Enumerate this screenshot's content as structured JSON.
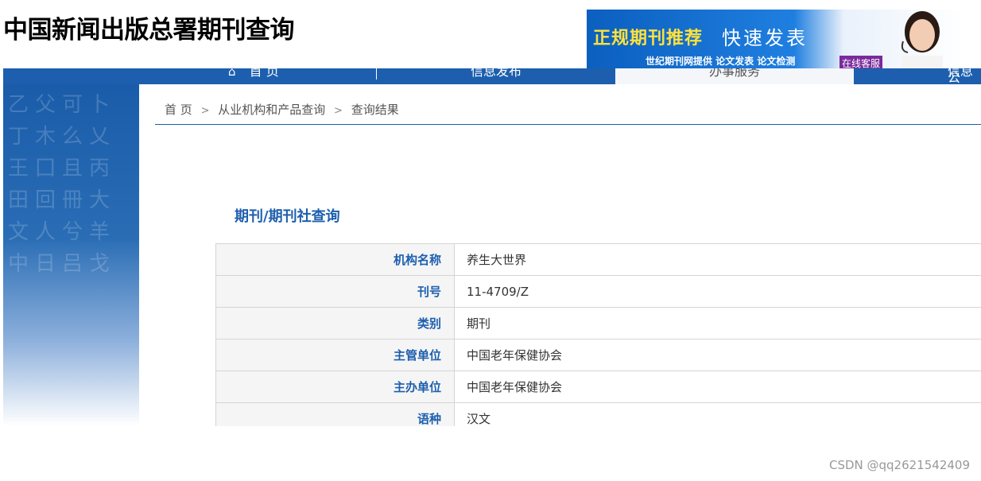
{
  "header": {
    "site_title": "中国新闻出版总署期刊查询"
  },
  "ad_banner": {
    "main_text": "正规期刊推荐",
    "sub_text": "快速发表",
    "line_text": "世纪期刊网提供  论文发表  论文检测",
    "chat_label": "在线客服"
  },
  "nav": {
    "items": [
      {
        "label": "首 页",
        "icon": "home-icon"
      },
      {
        "label": "信息发布"
      },
      {
        "label": "办事服务",
        "active": true
      },
      {
        "label": "信息公"
      }
    ]
  },
  "breadcrumb": {
    "items": [
      "首 页",
      "从业机构和产品查询",
      "查询结果"
    ],
    "separator": ">"
  },
  "section": {
    "title": "期刊/期刊社查询"
  },
  "results": [
    {
      "label": "机构名称",
      "value": "养生大世界"
    },
    {
      "label": "刊号",
      "value": "11-4709/Z"
    },
    {
      "label": "类别",
      "value": "期刊"
    },
    {
      "label": "主管单位",
      "value": "中国老年保健协会"
    },
    {
      "label": "主办单位",
      "value": "中国老年保健协会"
    },
    {
      "label": "语种",
      "value": "汉文"
    }
  ],
  "watermark": "CSDN @qq2621542409",
  "colors": {
    "primary_blue": "#1d5fae",
    "label_bg": "#f5f5f5"
  }
}
